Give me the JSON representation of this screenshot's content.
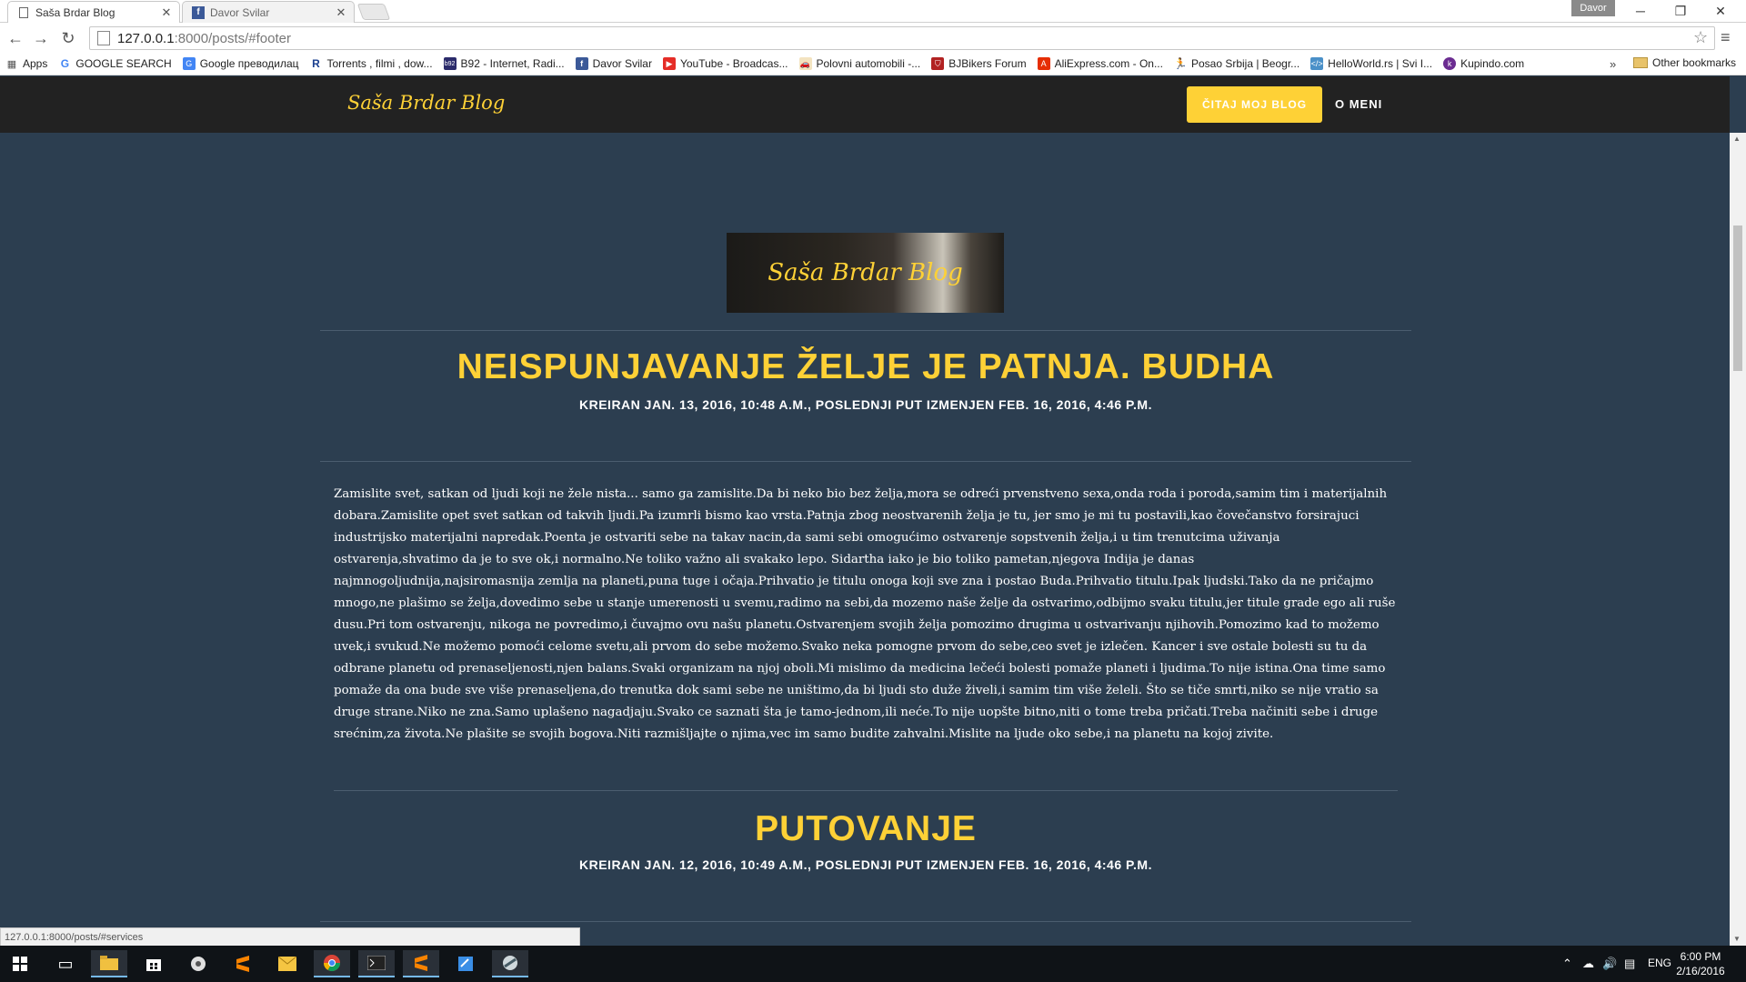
{
  "browser": {
    "tabs": [
      {
        "label": "Saša Brdar Blog",
        "active": true,
        "icon": "page-icon"
      },
      {
        "label": "Davor Svilar",
        "active": false,
        "icon": "facebook-icon"
      }
    ],
    "user": "Davor",
    "url_host": "127.0.0.1",
    "url_path": ":8000/posts/#footer",
    "bookmarks": [
      {
        "label": "Apps",
        "icon": "apps-icon"
      },
      {
        "label": "GOOGLE SEARCH",
        "icon": "google-icon"
      },
      {
        "label": "Google преводилац",
        "icon": "translate-icon"
      },
      {
        "label": "Torrents , filmi , dow...",
        "icon": "torrent-icon"
      },
      {
        "label": "B92 - Internet, Radi...",
        "icon": "b92-icon"
      },
      {
        "label": "Davor Svilar",
        "icon": "facebook-icon"
      },
      {
        "label": "YouTube - Broadcas...",
        "icon": "youtube-icon"
      },
      {
        "label": "Polovni automobili -...",
        "icon": "car-icon"
      },
      {
        "label": "BJBikers Forum",
        "icon": "shield-icon"
      },
      {
        "label": "AliExpress.com - On...",
        "icon": "aliexpress-icon"
      },
      {
        "label": "Posao Srbija | Beogr...",
        "icon": "runner-icon"
      },
      {
        "label": "HelloWorld.rs | Svi I...",
        "icon": "code-icon"
      },
      {
        "label": "Kupindo.com",
        "icon": "kupindo-icon"
      }
    ],
    "other_bookmarks": "Other bookmarks",
    "status_url": "127.0.0.1:8000/posts/#services"
  },
  "site": {
    "brand": "Saša Brdar Blog",
    "read_button": "ČITAJ MOJ BLOG",
    "about_link": "O MENI",
    "logo_text": "Saša Brdar Blog",
    "posts": [
      {
        "title": "NEISPUNJAVANJE ŽELJE JE PATNJA. BUDHA",
        "meta": "KREIRAN JAN. 13, 2016, 10:48 A.M., POSLEDNJI PUT IZMENJEN FEB. 16, 2016, 4:46 P.M.",
        "body": "Zamislite svet, satkan od ljudi koji ne žele nista... samo ga zamislite.Da bi neko bio bez želja,mora se odreći prvenstveno sexa,onda roda i poroda,samim tim i materijalnih dobara.Zamislite opet svet satkan od takvih ljudi.Pa izumrli bismo kao vrsta.Patnja zbog neostvarenih želja je tu, jer smo je mi tu postavili,kao čovečanstvo forsirajuci industrijsko materijalni napredak.Poenta je ostvariti sebe na takav nacin,da sami sebi omogućimo ostvarenje sopstvenih želja,i u tim trenutcima uživanja ostvarenja,shvatimo da je to sve ok,i normalno.Ne toliko važno ali svakako lepo. Sidartha iako je bio toliko pametan,njegova Indija je danas najmnogoljudnija,najsiromasnija zemlja na planeti,puna tuge i očaja.Prihvatio je titulu onoga koji sve zna i postao Buda.Prihvatio titulu.Ipak ljudski.Tako da ne pričajmo mnogo,ne plašimo se želja,dovedimo sebe u stanje umerenosti u svemu,radimo na sebi,da mozemo naše želje da ostvarimo,odbijmo svaku titulu,jer titule grade ego ali ruše dusu.Pri tom ostvarenju, nikoga ne povredimo,i čuvajmo ovu našu planetu.Ostvarenjem svojih želja pomozimo drugima u ostvarivanju njihovih.Pomozimo kad to možemo uvek,i svukud.Ne možemo pomoći celome svetu,ali prvom do sebe možemo.Svako neka pomogne prvom do sebe,ceo svet je izlečen. Kancer i sve ostale bolesti su tu da odbrane planetu od prenaseljenosti,njen balans.Svaki organizam na njoj oboli.Mi mislimo da medicina lečeći bolesti pomaže planeti i ljudima.To nije istina.Ona time samo pomaže da ona bude sve više prenaseljena,do trenutka dok sami sebe ne uništimo,da bi ljudi sto duže živeli,i samim tim više želeli. Što se tiče smrti,niko se nije vratio sa druge strane.Niko ne zna.Samo uplašeno nagadjaju.Svako ce saznati šta je tamo-jednom,ili neće.To nije uopšte bitno,niti o tome treba pričati.Treba načiniti sebe i druge srećnim,za života.Ne plašite se svojih bogova.Niti razmišljajte o njima,vec im samo budite zahvalni.Mislite na ljude oko sebe,i na planetu na kojoj zivite."
      },
      {
        "title": "PUTOVANJE",
        "meta": "KREIRAN JAN. 12, 2016, 10:49 A.M., POSLEDNJI PUT IZMENJEN FEB. 16, 2016, 4:46 P.M."
      }
    ]
  },
  "taskbar": {
    "lang": "ENG",
    "time": "6:00 PM",
    "date": "2/16/2016"
  },
  "colors": {
    "accent": "#fed136",
    "background": "#2c3e50",
    "navbar": "#222222"
  }
}
